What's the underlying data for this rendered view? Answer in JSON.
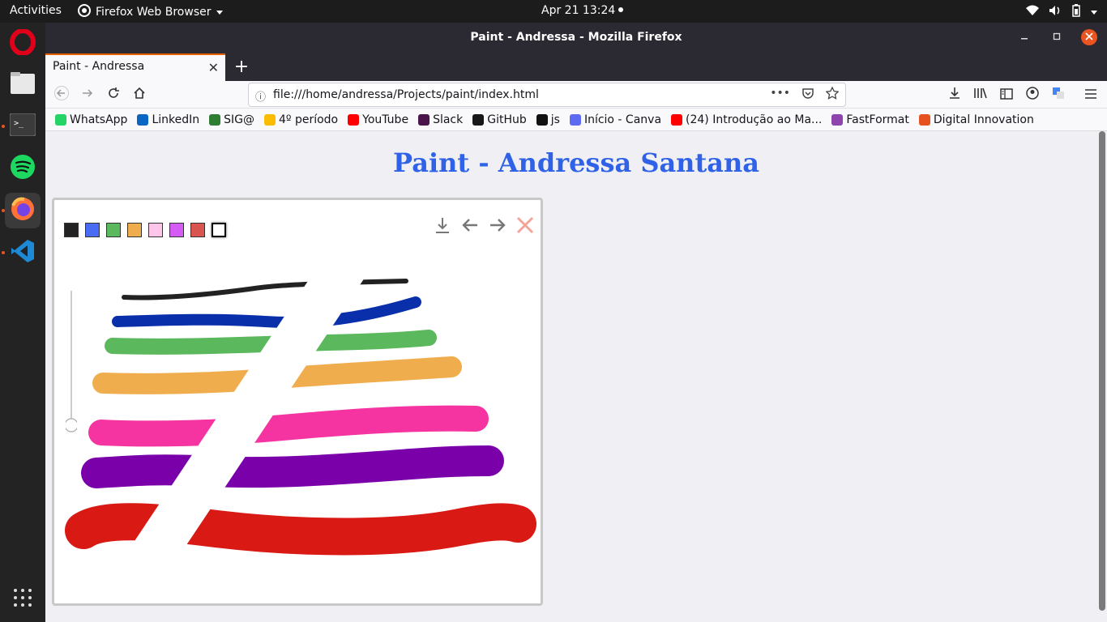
{
  "topbar": {
    "activities": "Activities",
    "app_name": "Firefox Web Browser",
    "clock": "Apr 21  13:24"
  },
  "window": {
    "title": "Paint - Andressa - Mozilla Firefox"
  },
  "tab": {
    "title": "Paint - Andressa"
  },
  "urlbar": {
    "url": "file:///home/andressa/Projects/paint/index.html"
  },
  "bookmarks": [
    {
      "label": "WhatsApp",
      "icon": "whatsapp-icon",
      "color": "#25d366"
    },
    {
      "label": "LinkedIn",
      "icon": "linkedin-icon",
      "color": "#0a66c2"
    },
    {
      "label": "SIG@",
      "icon": "sig-icon",
      "color": "#2e7d32"
    },
    {
      "label": "4º período",
      "icon": "google-drive-icon",
      "color": "#fbbc04"
    },
    {
      "label": "YouTube",
      "icon": "youtube-icon",
      "color": "#ff0000"
    },
    {
      "label": "Slack",
      "icon": "slack-icon",
      "color": "#4a154b"
    },
    {
      "label": "GitHub",
      "icon": "github-icon",
      "color": "#181717"
    },
    {
      "label": "js",
      "icon": "js-icon",
      "color": "#111111"
    },
    {
      "label": "Início - Canva",
      "icon": "canva-icon",
      "color": "#5c6bf2"
    },
    {
      "label": "(24) Introdução ao Ma...",
      "icon": "youtube-icon",
      "color": "#ff0000"
    },
    {
      "label": "FastFormat",
      "icon": "fastformat-icon",
      "color": "#8e44ad"
    },
    {
      "label": "Digital Innovation",
      "icon": "dio-icon",
      "color": "#e6521f"
    }
  ],
  "page": {
    "heading": "Paint - Andressa Santana"
  },
  "palette": [
    "#222222",
    "#4a6cf5",
    "#5cb85c",
    "#f0ad4e",
    "#ffc6ea",
    "#d45cf5",
    "#d9534f",
    "#ffffff"
  ],
  "strokes": [
    {
      "color": "#222222",
      "width": 6
    },
    {
      "color": "#0a2faa",
      "width": 14
    },
    {
      "color": "#5cb85c",
      "width": 20
    },
    {
      "color": "#f0ad4e",
      "width": 26
    },
    {
      "color": "#f533a1",
      "width": 32
    },
    {
      "color": "#7a00aa",
      "width": 38
    },
    {
      "color": "#d91a14",
      "width": 46
    }
  ],
  "icons": {
    "download": "download-icon",
    "undo": "undo-arrow-icon",
    "redo": "redo-arrow-icon",
    "clear": "clear-x-icon"
  }
}
